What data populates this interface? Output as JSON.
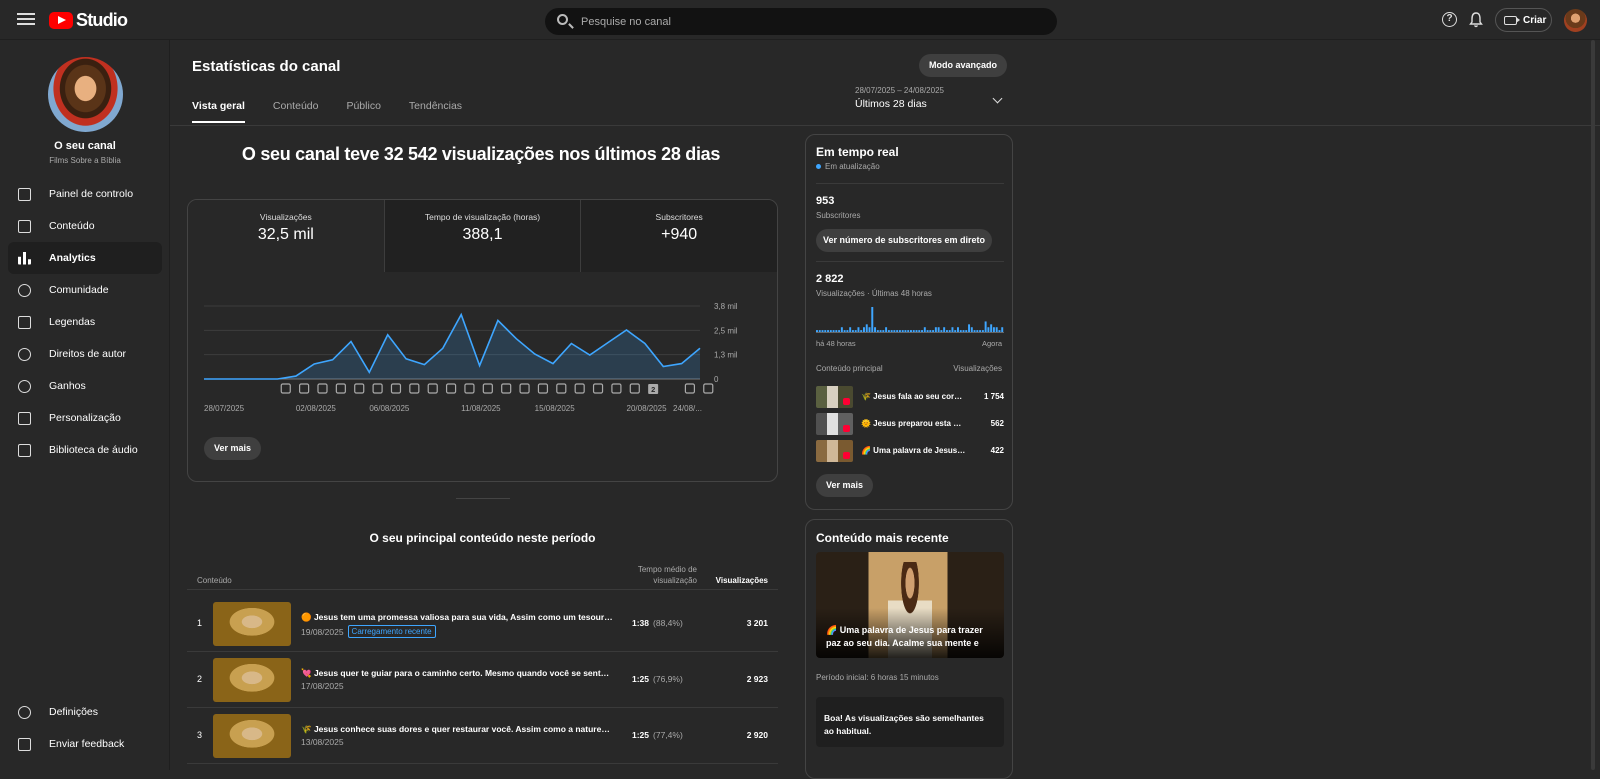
{
  "app": {
    "logo_text": "Studio"
  },
  "search": {
    "placeholder": "Pesquise no canal"
  },
  "topbar": {
    "create_label": "Criar"
  },
  "channel": {
    "name": "O seu canal",
    "subtitle": "Films Sobre a Bíblia"
  },
  "nav": [
    {
      "label": "Painel de controlo",
      "icon": "dashboard-icon"
    },
    {
      "label": "Conteúdo",
      "icon": "content-icon"
    },
    {
      "label": "Analytics",
      "icon": "analytics-icon",
      "active": true
    },
    {
      "label": "Comunidade",
      "icon": "community-icon"
    },
    {
      "label": "Legendas",
      "icon": "subtitles-icon"
    },
    {
      "label": "Direitos de autor",
      "icon": "copyright-icon"
    },
    {
      "label": "Ganhos",
      "icon": "earn-icon"
    },
    {
      "label": "Personalização",
      "icon": "customization-icon"
    },
    {
      "label": "Biblioteca de áudio",
      "icon": "audio-library-icon"
    }
  ],
  "nav_bottom": [
    {
      "label": "Definições",
      "icon": "settings-icon"
    },
    {
      "label": "Enviar feedback",
      "icon": "feedback-icon"
    }
  ],
  "page": {
    "title": "Estatísticas do canal",
    "advanced_label": "Modo avançado",
    "tabs": [
      "Vista geral",
      "Conteúdo",
      "Público",
      "Tendências"
    ],
    "date_range": "28/07/2025 – 24/08/2025",
    "period_label": "Últimos 28 dias",
    "headline": "O seu canal teve 32 542 visualizações nos últimos 28 dias"
  },
  "metrics": [
    {
      "label": "Visualizações",
      "value": "32,5 mil"
    },
    {
      "label": "Tempo de visualização (horas)",
      "value": "388,1"
    },
    {
      "label": "Subscritores",
      "value": "+940"
    }
  ],
  "chart_data": {
    "type": "area",
    "x_tick_labels": [
      "28/07/2025",
      "02/08/2025",
      "06/08/2025",
      "11/08/2025",
      "15/08/2025",
      "20/08/2025",
      "24/08/..."
    ],
    "y_tick_labels": [
      "3,8 mil",
      "2,5 mil",
      "1,3 mil",
      "0"
    ],
    "ylim": [
      0,
      3800
    ],
    "values": [
      0,
      0,
      0,
      0,
      0,
      150,
      780,
      1000,
      1950,
      350,
      2300,
      1050,
      750,
      1600,
      3350,
      700,
      3050,
      2100,
      1300,
      800,
      1850,
      1250,
      1900,
      2550,
      1850,
      650,
      800,
      1600
    ],
    "marker_badge": "2",
    "color": "#3ea6ff"
  },
  "stats_more_label": "Ver mais",
  "top_content": {
    "title": "O seu principal conteúdo neste período",
    "col_content": "Conteúdo",
    "col_avg": "Tempo médio de visualização",
    "col_views": "Visualizações",
    "rows": [
      {
        "rank": "1",
        "title": "🟠 Jesus tem uma promessa valiosa para sua vida, Assim como um tesouro raro.",
        "date": "19/08/2025",
        "badge": "Carregamento recente",
        "avg": "1:38",
        "avg_pct": "(88,4%)",
        "views": "3 201"
      },
      {
        "rank": "2",
        "title": "💘 Jesus quer te guiar para o caminho certo. Mesmo quando você se sente perdido",
        "date": "17/08/2025",
        "badge": "",
        "avg": "1:25",
        "avg_pct": "(76,9%)",
        "views": "2 923"
      },
      {
        "rank": "3",
        "title": "🌾 Jesus conhece suas dores e quer restaurar você. Assim como a natureza se renova",
        "date": "13/08/2025",
        "badge": "",
        "avg": "1:25",
        "avg_pct": "(77,4%)",
        "views": "2 920"
      }
    ]
  },
  "realtime": {
    "title": "Em tempo real",
    "status": "Em atualização",
    "subs_value": "953",
    "subs_label": "Subscritores",
    "subs_button": "Ver número de subscritores em direto",
    "views_value": "2 822",
    "views_label": "Visualizações · Últimas 48 horas",
    "axis_start": "há 48 horas",
    "axis_end": "Agora",
    "spark_values": [
      1,
      1,
      1,
      1,
      1,
      1,
      1,
      1,
      1,
      2,
      1,
      1,
      2,
      1,
      1,
      2,
      1,
      2,
      3,
      2,
      9,
      2,
      1,
      1,
      1,
      2,
      1,
      1,
      1,
      1,
      1,
      1,
      1,
      1,
      1,
      1,
      1,
      1,
      1,
      2,
      1,
      1,
      1,
      2,
      2,
      1,
      2,
      1,
      1,
      2,
      1,
      2,
      1,
      1,
      1,
      3,
      2,
      1,
      1,
      1,
      1,
      4,
      2,
      3,
      2,
      2,
      1,
      2
    ],
    "col_content": "Conteúdo principal",
    "col_views": "Visualizações",
    "items": [
      {
        "title": "🌾 Jesus fala ao seu coração",
        "views": "1 754"
      },
      {
        "title": "🌞 Jesus preparou esta palavra",
        "views": "562"
      },
      {
        "title": "🌈 Uma palavra de Jesus para você",
        "views": "422"
      }
    ],
    "more_label": "Ver mais"
  },
  "recent": {
    "title": "Conteúdo mais recente",
    "caption": "🌈 Uma palavra de Jesus para trazer paz ao seu dia. Acalme sua mente e receba...",
    "period": "Período inicial: 6 horas 15 minutos",
    "note": "Boa! As visualizações são semelhantes ao habitual."
  }
}
